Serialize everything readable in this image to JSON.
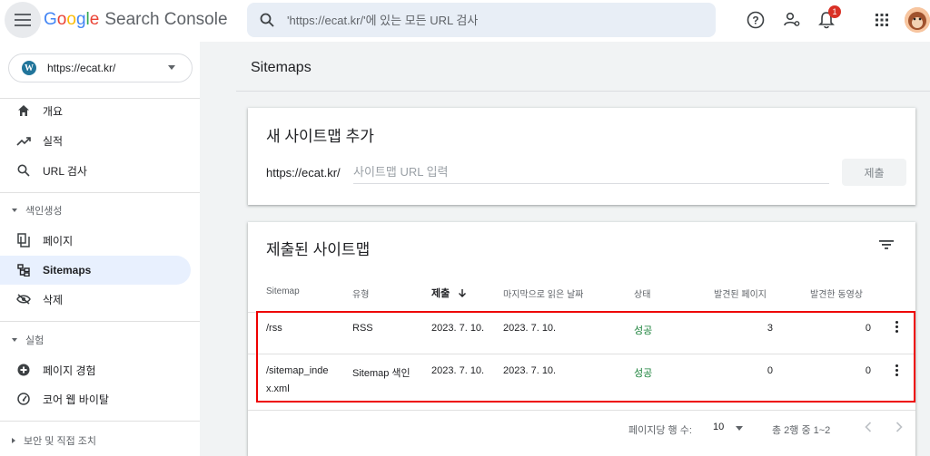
{
  "header": {
    "logo_letters": [
      "G",
      "o",
      "o",
      "g",
      "l",
      "e"
    ],
    "logo_colors": [
      "#4285f4",
      "#ea4335",
      "#fbbc05",
      "#4285f4",
      "#34a853",
      "#ea4335"
    ],
    "product": "Search Console",
    "search_placeholder": "'https://ecat.kr/'에 있는 모든 URL 검사",
    "notification_count": "1"
  },
  "sidebar": {
    "property_url": "https://ecat.kr/",
    "items": [
      {
        "label": "개요",
        "icon": "home-icon"
      },
      {
        "label": "실적",
        "icon": "trending-up-icon"
      },
      {
        "label": "URL 검사",
        "icon": "search-icon"
      }
    ],
    "section_index": {
      "label": "색인생성"
    },
    "index_items": [
      {
        "label": "페이지",
        "icon": "pages-icon"
      },
      {
        "label": "Sitemaps",
        "icon": "sitemap-icon",
        "active": true
      },
      {
        "label": "삭제",
        "icon": "eye-off-icon"
      }
    ],
    "section_experience": {
      "label": "실험"
    },
    "experience_items": [
      {
        "label": "페이지 경험",
        "icon": "plus-circle-icon"
      },
      {
        "label": "코어 웹 바이탈",
        "icon": "gauge-icon"
      }
    ],
    "section_security": {
      "label": "보안 및 직접 조치"
    }
  },
  "main": {
    "page_title": "Sitemaps",
    "add_card": {
      "title": "새 사이트맵 추가",
      "prefix": "https://ecat.kr/",
      "input_placeholder": "사이트맵 URL 입력",
      "submit_label": "제출"
    },
    "submitted_card": {
      "title": "제출된 사이트맵",
      "columns": {
        "sitemap": "Sitemap",
        "type": "유형",
        "submitted": "제출",
        "last_read": "마지막으로 읽은 날짜",
        "status": "상태",
        "pages": "발견된 페이지",
        "videos": "발견한 동영상"
      },
      "rows": [
        {
          "sitemap": "/rss",
          "type": "RSS",
          "submitted": "2023. 7. 10.",
          "last_read": "2023. 7. 10.",
          "status": "성공",
          "pages": "3",
          "videos": "0"
        },
        {
          "sitemap_l1": "/sitemap_inde",
          "sitemap_l2": "x.xml",
          "type": "Sitemap 색인",
          "submitted": "2023. 7. 10.",
          "last_read": "2023. 7. 10.",
          "status": "성공",
          "pages": "0",
          "videos": "0"
        }
      ],
      "footer": {
        "rows_per_page_label": "페이지당 행 수:",
        "rows_per_page_value": "10",
        "range_text": "총 2행 중 1~2"
      }
    },
    "status_color": "#188038",
    "highlight_color": "#ee0000"
  }
}
